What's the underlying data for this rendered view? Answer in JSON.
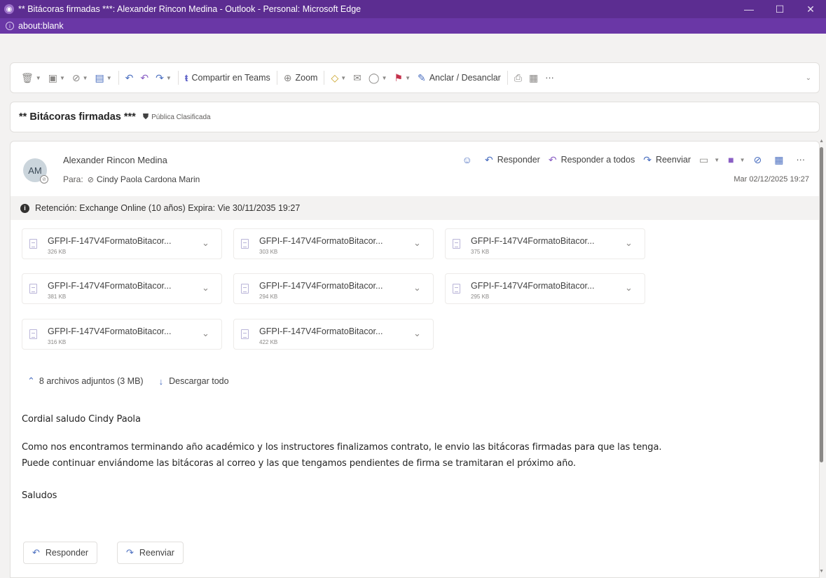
{
  "window": {
    "title": "** Bitácoras firmadas ***: Alexander Rincon Medina - Outlook - Personal: Microsoft Edge",
    "url": "about:blank",
    "controls": [
      "minimize",
      "maximize",
      "close"
    ]
  },
  "toolbar": {
    "teams_label": "Compartir en Teams",
    "zoom_label": "Zoom",
    "pin_label": "Anclar / Desanclar",
    "more_label": "···"
  },
  "subject": {
    "text": "** Bitácoras firmadas ***",
    "classification": "Pública Clasificada"
  },
  "message": {
    "avatar_initials": "AM",
    "sender": "Alexander Rincon Medina",
    "to_label": "Para:",
    "recipient": "Cindy Paola Cardona Marin",
    "date": "Mar 02/12/2025 19:27",
    "actions": {
      "reply": "Responder",
      "reply_all": "Responder a todos",
      "forward": "Reenviar",
      "more": "···"
    },
    "retention": "Retención: Exchange Online (10 años) Expira: Vie 30/11/2035 19:27"
  },
  "attachments": [
    {
      "name": "GFPI-F-147V4FormatoBitacor...",
      "size": "326 KB"
    },
    {
      "name": "GFPI-F-147V4FormatoBitacor...",
      "size": "303 KB"
    },
    {
      "name": "GFPI-F-147V4FormatoBitacor...",
      "size": "375 KB"
    },
    {
      "name": "GFPI-F-147V4FormatoBitacor...",
      "size": "381 KB"
    },
    {
      "name": "GFPI-F-147V4FormatoBitacor...",
      "size": "294 KB"
    },
    {
      "name": "GFPI-F-147V4FormatoBitacor...",
      "size": "295 KB"
    },
    {
      "name": "GFPI-F-147V4FormatoBitacor...",
      "size": "316 KB"
    },
    {
      "name": "GFPI-F-147V4FormatoBitacor...",
      "size": "422 KB"
    }
  ],
  "attachments_summary": {
    "count_label": "8 archivos adjuntos (3 MB)",
    "download_all": "Descargar todo"
  },
  "body": {
    "greeting": "Cordial saludo Cindy Paola",
    "line1": "Como nos encontramos terminando año académico y los instructores finalizamos contrato, le envio las bitácoras firmadas para que las tenga.",
    "line2": "Puede continuar enviándome las bitácoras al correo y las que tengamos pendientes de firma se tramitaran el próximo año.",
    "closing": "Saludos"
  },
  "footer": {
    "reply": "Responder",
    "forward": "Reenviar"
  },
  "colors": {
    "titlebar": "#5c2d91",
    "accent": "#4b6fc0"
  }
}
